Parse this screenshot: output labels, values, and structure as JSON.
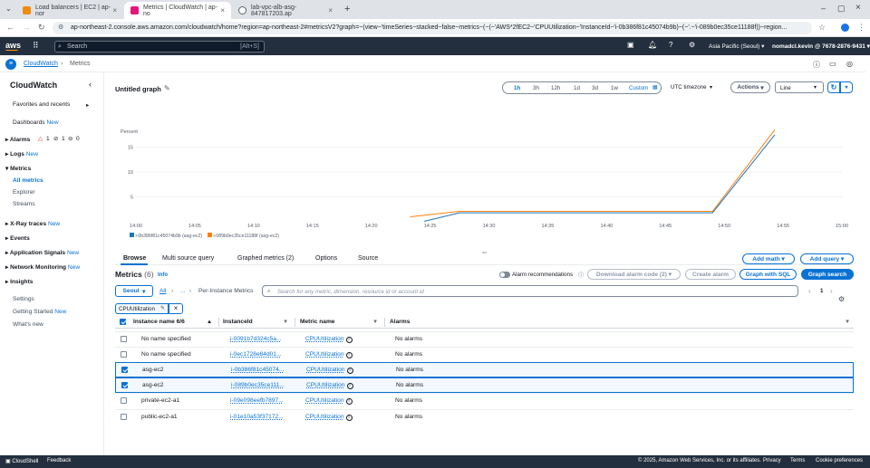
{
  "browser": {
    "tabs": [
      {
        "title": "Load balancers | EC2 | ap-nor",
        "color": "#f28b0c"
      },
      {
        "title": "Metrics | CloudWatch | ap-no",
        "color": "#e7157b"
      },
      {
        "title": "lab-vpc-alb-asg-847817203.ap",
        "color": "#5f6368"
      }
    ],
    "url": "ap-northeast-2.console.aws.amazon.com/cloudwatch/home?region=ap-northeast-2#metricsV2?graph=~(view~'timeSeries~stacked~false~metrics~(~(~'AWS*2fEC2~'CPUUtilization~'InstanceId~'i-0b386f81c45074b9b)~(~'.~'i-089b0ec35ce11188f))~region..."
  },
  "aws_nav": {
    "logo": "aws",
    "search_placeholder": "Search",
    "search_hint": "[Alt+S]",
    "region": "Asia Pacific (Seoul)",
    "account": "nomadcl.kevin @ 7678-2876-9431"
  },
  "breadcrumb": {
    "root": "CloudWatch",
    "current": "Metrics"
  },
  "sidebar": {
    "title": "CloudWatch",
    "favorites": "Favorites and recents",
    "dashboards": "Dashboards",
    "new": "New",
    "alarms": "Alarms",
    "alarm_counts": [
      "1",
      "1",
      "0"
    ],
    "logs": "Logs",
    "metrics": "Metrics",
    "all_metrics": "All metrics",
    "explorer": "Explorer",
    "streams": "Streams",
    "xray": "X-Ray traces",
    "events": "Events",
    "app_signals": "Application Signals",
    "network": "Network Monitoring",
    "insights": "Insights",
    "settings": "Settings",
    "getting_started": "Getting Started",
    "whats_new": "What's new"
  },
  "graph": {
    "title": "Untitled graph",
    "ranges": [
      "1h",
      "3h",
      "12h",
      "1d",
      "3d",
      "1w",
      "Custom"
    ],
    "active_range": "1h",
    "timezone": "UTC timezone",
    "actions": "Actions",
    "chart_type": "Line"
  },
  "chart_data": {
    "type": "line",
    "ylabel": "Percent",
    "yticks": [
      5,
      10,
      15
    ],
    "ylim": [
      0,
      20
    ],
    "xticks": [
      "14:00",
      "14:05",
      "14:10",
      "14:15",
      "14:20",
      "14:25",
      "14:30",
      "14:35",
      "14:40",
      "14:45",
      "14:50",
      "14:55",
      "15:00"
    ],
    "series": [
      {
        "name": "i-0b386f81c45074b9b (asg-ec2)",
        "color": "#1f77b4",
        "points": [
          [
            24.5,
            0.1
          ],
          [
            27.5,
            1.8
          ],
          [
            31.5,
            1.8
          ],
          [
            45,
            1.8
          ],
          [
            49,
            1.8
          ],
          [
            54.3,
            17.5
          ]
        ]
      },
      {
        "name": "i-089b0ec35ce11188f (asg-ec2)",
        "color": "#ff7f0e",
        "points": [
          [
            23.3,
            1.0
          ],
          [
            27.5,
            2.1
          ],
          [
            31.5,
            2.1
          ],
          [
            45,
            2.1
          ],
          [
            49,
            2.1
          ],
          [
            54.3,
            18.5
          ]
        ]
      }
    ]
  },
  "tabs": {
    "items": [
      "Browse",
      "Multi source query",
      "Graphed metrics (2)",
      "Options",
      "Source"
    ],
    "active": "Browse",
    "add_math": "Add math",
    "add_query": "Add query"
  },
  "metrics_panel": {
    "title": "Metrics",
    "count": "(6)",
    "info": "Info",
    "alarm_rec": "Alarm recommendations",
    "download_alarm": "Download alarm code (2)",
    "create_alarm": "Create alarm",
    "graph_sql": "Graph with SQL",
    "graph_search": "Graph search",
    "region_filter": "Seoul",
    "crumb_all": "All",
    "crumb_dots": "...",
    "crumb_per_instance": "Per-Instance Metrics",
    "search_placeholder": "Search for any metric, dimension, resource id or account id",
    "page": "1",
    "filter_token": "CPUUtilization",
    "columns": [
      "Instance name 6/6",
      "InstanceId",
      "Metric name",
      "Alarms"
    ],
    "rows": [
      {
        "checked": false,
        "name": "No name specified",
        "id": "i-0091b7d324c5a...",
        "metric": "CPUUtilization",
        "alarms": "No alarms"
      },
      {
        "checked": false,
        "name": "No name specified",
        "id": "i-0ec1728e84d01...",
        "metric": "CPUUtilization",
        "alarms": "No alarms"
      },
      {
        "checked": true,
        "name": "asg-ec2",
        "id": "i-0b386f81c45074...",
        "metric": "CPUUtilization",
        "alarms": "No alarms"
      },
      {
        "checked": true,
        "name": "asg-ec2",
        "id": "i-089b0ec35ce111...",
        "metric": "CPUUtilization",
        "alarms": "No alarms"
      },
      {
        "checked": false,
        "name": "private-ec2-a1",
        "id": "i-09e098eefb7897...",
        "metric": "CPUUtilization",
        "alarms": "No alarms"
      },
      {
        "checked": false,
        "name": "public-ec2-a1",
        "id": "i-01e10a53f37172...",
        "metric": "CPUUtilization",
        "alarms": "No alarms"
      }
    ]
  },
  "footer": {
    "cloudshell": "CloudShell",
    "feedback": "Feedback",
    "copyright": "© 2025, Amazon Web Services, Inc. or its affiliates.",
    "privacy": "Privacy",
    "terms": "Terms",
    "cookies": "Cookie preferences"
  }
}
